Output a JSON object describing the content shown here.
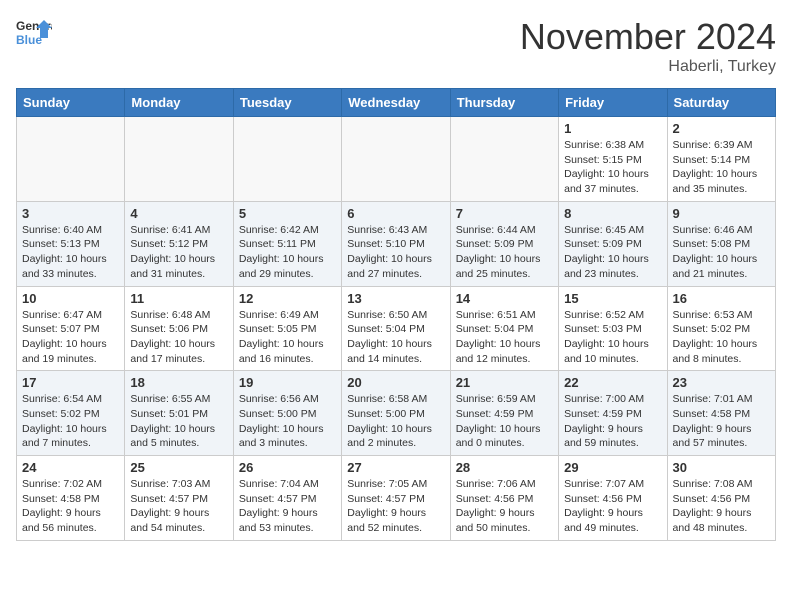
{
  "logo": {
    "line1": "General",
    "line2": "Blue"
  },
  "title": "November 2024",
  "subtitle": "Haberli, Turkey",
  "weekdays": [
    "Sunday",
    "Monday",
    "Tuesday",
    "Wednesday",
    "Thursday",
    "Friday",
    "Saturday"
  ],
  "weeks": [
    [
      {
        "day": "",
        "info": ""
      },
      {
        "day": "",
        "info": ""
      },
      {
        "day": "",
        "info": ""
      },
      {
        "day": "",
        "info": ""
      },
      {
        "day": "",
        "info": ""
      },
      {
        "day": "1",
        "info": "Sunrise: 6:38 AM\nSunset: 5:15 PM\nDaylight: 10 hours\nand 37 minutes."
      },
      {
        "day": "2",
        "info": "Sunrise: 6:39 AM\nSunset: 5:14 PM\nDaylight: 10 hours\nand 35 minutes."
      }
    ],
    [
      {
        "day": "3",
        "info": "Sunrise: 6:40 AM\nSunset: 5:13 PM\nDaylight: 10 hours\nand 33 minutes."
      },
      {
        "day": "4",
        "info": "Sunrise: 6:41 AM\nSunset: 5:12 PM\nDaylight: 10 hours\nand 31 minutes."
      },
      {
        "day": "5",
        "info": "Sunrise: 6:42 AM\nSunset: 5:11 PM\nDaylight: 10 hours\nand 29 minutes."
      },
      {
        "day": "6",
        "info": "Sunrise: 6:43 AM\nSunset: 5:10 PM\nDaylight: 10 hours\nand 27 minutes."
      },
      {
        "day": "7",
        "info": "Sunrise: 6:44 AM\nSunset: 5:09 PM\nDaylight: 10 hours\nand 25 minutes."
      },
      {
        "day": "8",
        "info": "Sunrise: 6:45 AM\nSunset: 5:09 PM\nDaylight: 10 hours\nand 23 minutes."
      },
      {
        "day": "9",
        "info": "Sunrise: 6:46 AM\nSunset: 5:08 PM\nDaylight: 10 hours\nand 21 minutes."
      }
    ],
    [
      {
        "day": "10",
        "info": "Sunrise: 6:47 AM\nSunset: 5:07 PM\nDaylight: 10 hours\nand 19 minutes."
      },
      {
        "day": "11",
        "info": "Sunrise: 6:48 AM\nSunset: 5:06 PM\nDaylight: 10 hours\nand 17 minutes."
      },
      {
        "day": "12",
        "info": "Sunrise: 6:49 AM\nSunset: 5:05 PM\nDaylight: 10 hours\nand 16 minutes."
      },
      {
        "day": "13",
        "info": "Sunrise: 6:50 AM\nSunset: 5:04 PM\nDaylight: 10 hours\nand 14 minutes."
      },
      {
        "day": "14",
        "info": "Sunrise: 6:51 AM\nSunset: 5:04 PM\nDaylight: 10 hours\nand 12 minutes."
      },
      {
        "day": "15",
        "info": "Sunrise: 6:52 AM\nSunset: 5:03 PM\nDaylight: 10 hours\nand 10 minutes."
      },
      {
        "day": "16",
        "info": "Sunrise: 6:53 AM\nSunset: 5:02 PM\nDaylight: 10 hours\nand 8 minutes."
      }
    ],
    [
      {
        "day": "17",
        "info": "Sunrise: 6:54 AM\nSunset: 5:02 PM\nDaylight: 10 hours\nand 7 minutes."
      },
      {
        "day": "18",
        "info": "Sunrise: 6:55 AM\nSunset: 5:01 PM\nDaylight: 10 hours\nand 5 minutes."
      },
      {
        "day": "19",
        "info": "Sunrise: 6:56 AM\nSunset: 5:00 PM\nDaylight: 10 hours\nand 3 minutes."
      },
      {
        "day": "20",
        "info": "Sunrise: 6:58 AM\nSunset: 5:00 PM\nDaylight: 10 hours\nand 2 minutes."
      },
      {
        "day": "21",
        "info": "Sunrise: 6:59 AM\nSunset: 4:59 PM\nDaylight: 10 hours\nand 0 minutes."
      },
      {
        "day": "22",
        "info": "Sunrise: 7:00 AM\nSunset: 4:59 PM\nDaylight: 9 hours\nand 59 minutes."
      },
      {
        "day": "23",
        "info": "Sunrise: 7:01 AM\nSunset: 4:58 PM\nDaylight: 9 hours\nand 57 minutes."
      }
    ],
    [
      {
        "day": "24",
        "info": "Sunrise: 7:02 AM\nSunset: 4:58 PM\nDaylight: 9 hours\nand 56 minutes."
      },
      {
        "day": "25",
        "info": "Sunrise: 7:03 AM\nSunset: 4:57 PM\nDaylight: 9 hours\nand 54 minutes."
      },
      {
        "day": "26",
        "info": "Sunrise: 7:04 AM\nSunset: 4:57 PM\nDaylight: 9 hours\nand 53 minutes."
      },
      {
        "day": "27",
        "info": "Sunrise: 7:05 AM\nSunset: 4:57 PM\nDaylight: 9 hours\nand 52 minutes."
      },
      {
        "day": "28",
        "info": "Sunrise: 7:06 AM\nSunset: 4:56 PM\nDaylight: 9 hours\nand 50 minutes."
      },
      {
        "day": "29",
        "info": "Sunrise: 7:07 AM\nSunset: 4:56 PM\nDaylight: 9 hours\nand 49 minutes."
      },
      {
        "day": "30",
        "info": "Sunrise: 7:08 AM\nSunset: 4:56 PM\nDaylight: 9 hours\nand 48 minutes."
      }
    ]
  ]
}
